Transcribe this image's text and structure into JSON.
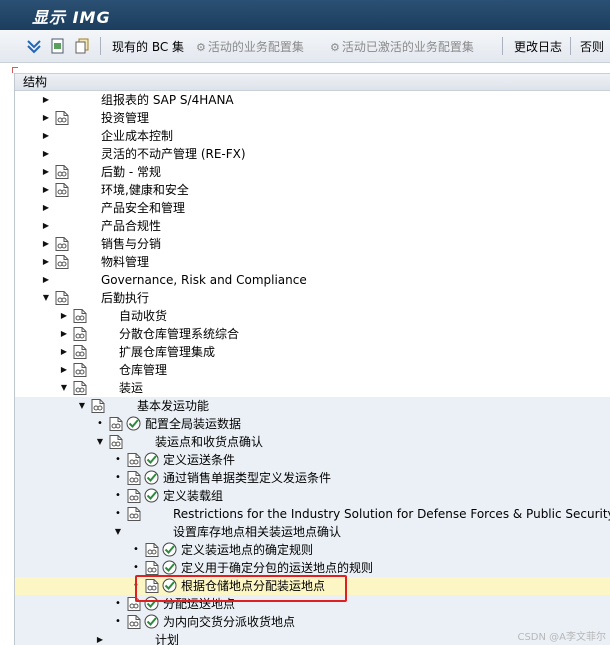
{
  "window": {
    "title": "显示 IMG"
  },
  "toolbar": {
    "icons": [
      "expand-tree-icon",
      "find-icon",
      "copy-icon"
    ],
    "bc_set_label": "现有的 BC 集",
    "activity_bc_label": "活动的业务配置集",
    "activity_bc_inactive_label": "活动已激活的业务配置集",
    "change_log_label": "更改日志",
    "next_label": "否则"
  },
  "tree": {
    "header": "结构",
    "rows": [
      {
        "label": "组报表的 SAP S/4HANA",
        "level": 0,
        "twisty": "collapsed",
        "doc": false,
        "exe": false
      },
      {
        "label": "投资管理",
        "level": 0,
        "twisty": "collapsed",
        "doc": true,
        "exe": false
      },
      {
        "label": "企业成本控制",
        "level": 0,
        "twisty": "collapsed",
        "doc": false,
        "exe": false
      },
      {
        "label": "灵活的不动产管理 (RE-FX)",
        "level": 0,
        "twisty": "collapsed",
        "doc": false,
        "exe": false
      },
      {
        "label": "后勤 - 常规",
        "level": 0,
        "twisty": "collapsed",
        "doc": true,
        "exe": false
      },
      {
        "label": "环境,健康和安全",
        "level": 0,
        "twisty": "collapsed",
        "doc": true,
        "exe": false
      },
      {
        "label": "产品安全和管理",
        "level": 0,
        "twisty": "collapsed",
        "doc": false,
        "exe": false
      },
      {
        "label": "产品合规性",
        "level": 0,
        "twisty": "collapsed",
        "doc": false,
        "exe": false
      },
      {
        "label": "销售与分销",
        "level": 0,
        "twisty": "collapsed",
        "doc": true,
        "exe": false
      },
      {
        "label": "物料管理",
        "level": 0,
        "twisty": "collapsed",
        "doc": true,
        "exe": false
      },
      {
        "label": "Governance, Risk and Compliance",
        "level": 0,
        "twisty": "collapsed",
        "doc": false,
        "exe": false
      },
      {
        "label": "后勤执行",
        "level": 0,
        "twisty": "expanded",
        "doc": true,
        "exe": false
      },
      {
        "label": "自动收货",
        "level": 1,
        "twisty": "collapsed",
        "doc": true,
        "exe": false
      },
      {
        "label": "分散仓库管理系统综合",
        "level": 1,
        "twisty": "collapsed",
        "doc": true,
        "exe": false
      },
      {
        "label": "扩展仓库管理集成",
        "level": 1,
        "twisty": "collapsed",
        "doc": true,
        "exe": false
      },
      {
        "label": "仓库管理",
        "level": 1,
        "twisty": "collapsed",
        "doc": true,
        "exe": false
      },
      {
        "label": "装运",
        "level": 1,
        "twisty": "expanded",
        "doc": true,
        "exe": false
      },
      {
        "label": "基本发运功能",
        "level": 2,
        "twisty": "expanded",
        "doc": true,
        "exe": false
      },
      {
        "label": "配置全局装运数据",
        "level": 3,
        "twisty": "leaf",
        "doc": true,
        "exe": true
      },
      {
        "label": "装运点和收货点确认",
        "level": 3,
        "twisty": "expanded",
        "doc": true,
        "exe": false
      },
      {
        "label": "定义运送条件",
        "level": 4,
        "twisty": "leaf",
        "doc": true,
        "exe": true
      },
      {
        "label": "通过销售单据类型定义发运条件",
        "level": 4,
        "twisty": "leaf",
        "doc": true,
        "exe": true
      },
      {
        "label": "定义装载组",
        "level": 4,
        "twisty": "leaf",
        "doc": true,
        "exe": true
      },
      {
        "label": "Restrictions for the Industry Solution for Defense Forces & Public Security",
        "level": 4,
        "twisty": "leaf",
        "doc": true,
        "exe": false
      },
      {
        "label": "设置库存地点相关装运地点确认",
        "level": 4,
        "twisty": "expanded",
        "doc": false,
        "exe": false
      },
      {
        "label": "定义装运地点的确定规则",
        "level": 5,
        "twisty": "leaf",
        "doc": true,
        "exe": true
      },
      {
        "label": "定义用于确定分包的运送地点的规则",
        "level": 5,
        "twisty": "leaf",
        "doc": true,
        "exe": true
      },
      {
        "label": "根据仓储地点分配装运地点",
        "level": 5,
        "twisty": "leaf",
        "doc": true,
        "exe": true,
        "selected": true
      },
      {
        "label": "分配运送地点",
        "level": 4,
        "twisty": "leaf",
        "doc": true,
        "exe": true
      },
      {
        "label": "为内向交货分派收货地点",
        "level": 4,
        "twisty": "leaf",
        "doc": true,
        "exe": true
      },
      {
        "label": "计划",
        "level": 3,
        "twisty": "collapsed",
        "doc": false,
        "exe": false
      }
    ]
  },
  "watermark": "CSDN @A李文菲尔",
  "colors": {
    "title_bg": "#1c3e5e",
    "highlight": "#fbf6c3",
    "selection_box": "#e02020",
    "exe_icon": "#2e8b3e"
  }
}
